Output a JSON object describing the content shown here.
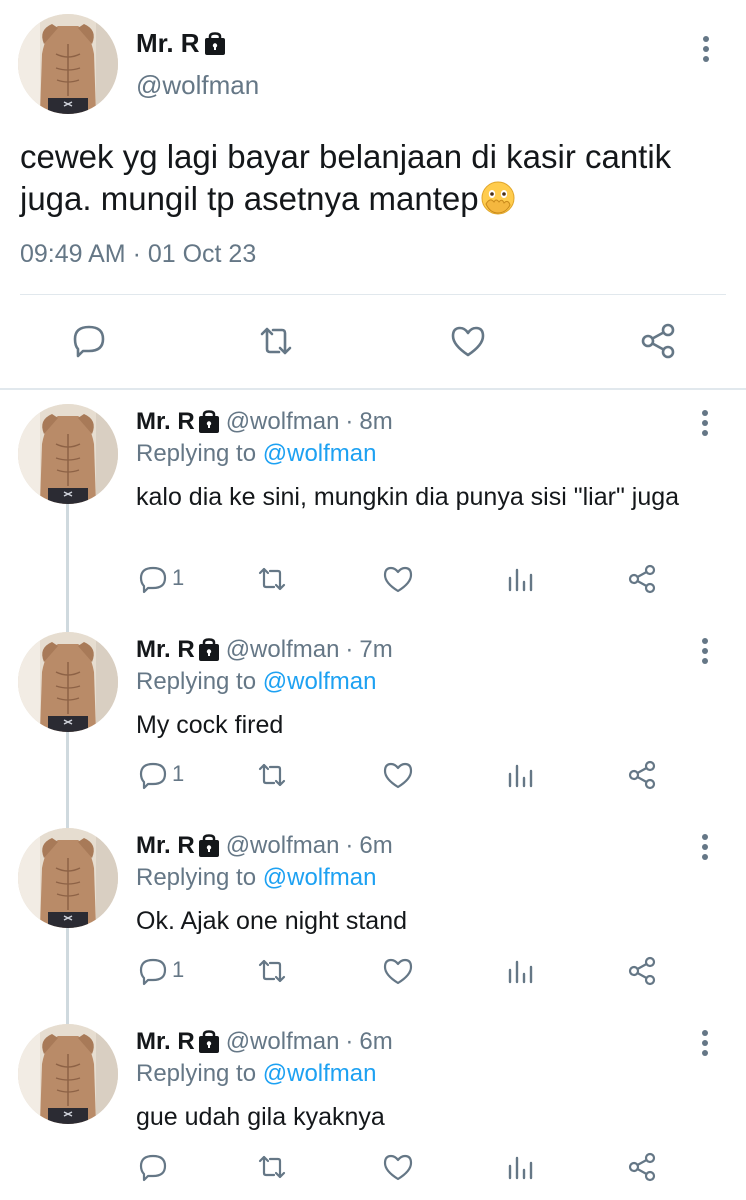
{
  "main_tweet": {
    "display_name": "Mr. R",
    "handle": "@wolfman",
    "text": "cewek yg lagi bayar belanjaan di kasir cantik juga. mungil tp asetnya mantep",
    "emoji": "face-with-open-eyes-and-hand-over-mouth",
    "timestamp": "09:49 AM · 01 Oct 23",
    "actions": [
      "reply-icon",
      "retweet-icon",
      "like-icon",
      "share-icon"
    ]
  },
  "replies": [
    {
      "display_name": "Mr. R",
      "handle": "@wolfman",
      "separator": "·",
      "time": "8m",
      "replying_prefix": "Replying to",
      "replying_to": "@wolfman",
      "text": "kalo dia ke sini, mungkin dia punya sisi \"liar\" juga",
      "reply_count": "1"
    },
    {
      "display_name": "Mr. R",
      "handle": "@wolfman",
      "separator": "·",
      "time": "7m",
      "replying_prefix": "Replying to",
      "replying_to": "@wolfman",
      "text": "My cock fired",
      "reply_count": "1"
    },
    {
      "display_name": "Mr. R",
      "handle": "@wolfman",
      "separator": "·",
      "time": "6m",
      "replying_prefix": "Replying to",
      "replying_to": "@wolfman",
      "text": "Ok. Ajak one night stand",
      "reply_count": "1"
    },
    {
      "display_name": "Mr. R",
      "handle": "@wolfman",
      "separator": "·",
      "time": "6m",
      "replying_prefix": "Replying to",
      "replying_to": "@wolfman",
      "text": "gue udah gila kyaknya",
      "reply_count": ""
    }
  ],
  "colors": {
    "text": "#14171a",
    "secondary": "#657786",
    "link": "#1da1f2",
    "divider": "#e1e8ed"
  }
}
